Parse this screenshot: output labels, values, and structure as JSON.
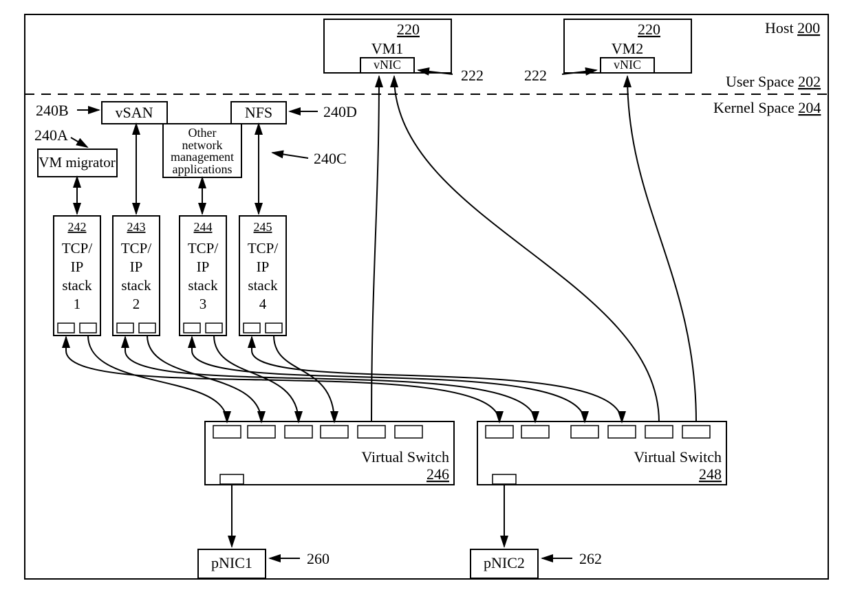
{
  "host": {
    "label": "Host",
    "ref": "200"
  },
  "userSpace": {
    "label": "User Space",
    "ref": "202"
  },
  "kernelSpace": {
    "label": "Kernel Space",
    "ref": "204"
  },
  "vm1": {
    "label": "VM1",
    "ref": "220",
    "vnic": "vNIC"
  },
  "vm2": {
    "label": "VM2",
    "ref": "220",
    "vnic": "vNIC"
  },
  "vnicRef1": "222",
  "vnicRef2": "222",
  "vsan": {
    "label": "vSAN",
    "ref": "240B"
  },
  "nfs": {
    "label": "NFS",
    "ref": "240D"
  },
  "vmMigrator": {
    "label": "VM migrator",
    "ref": "240A"
  },
  "otherApps": {
    "line1": "Other",
    "line2": "network",
    "line3": "management",
    "line4": "applications",
    "ref": "240C"
  },
  "stack1": {
    "ref": "242",
    "l1": "TCP/",
    "l2": "IP",
    "l3": "stack",
    "l4": "1"
  },
  "stack2": {
    "ref": "243",
    "l1": "TCP/",
    "l2": "IP",
    "l3": "stack",
    "l4": "2"
  },
  "stack3": {
    "ref": "244",
    "l1": "TCP/",
    "l2": "IP",
    "l3": "stack",
    "l4": "3"
  },
  "stack4": {
    "ref": "245",
    "l1": "TCP/",
    "l2": "IP",
    "l3": "stack",
    "l4": "4"
  },
  "vswitch1": {
    "label": "Virtual Switch",
    "ref": "246"
  },
  "vswitch2": {
    "label": "Virtual Switch",
    "ref": "248"
  },
  "pnic1": {
    "label": "pNIC1",
    "ref": "260"
  },
  "pnic2": {
    "label": "pNIC2",
    "ref": "262"
  }
}
